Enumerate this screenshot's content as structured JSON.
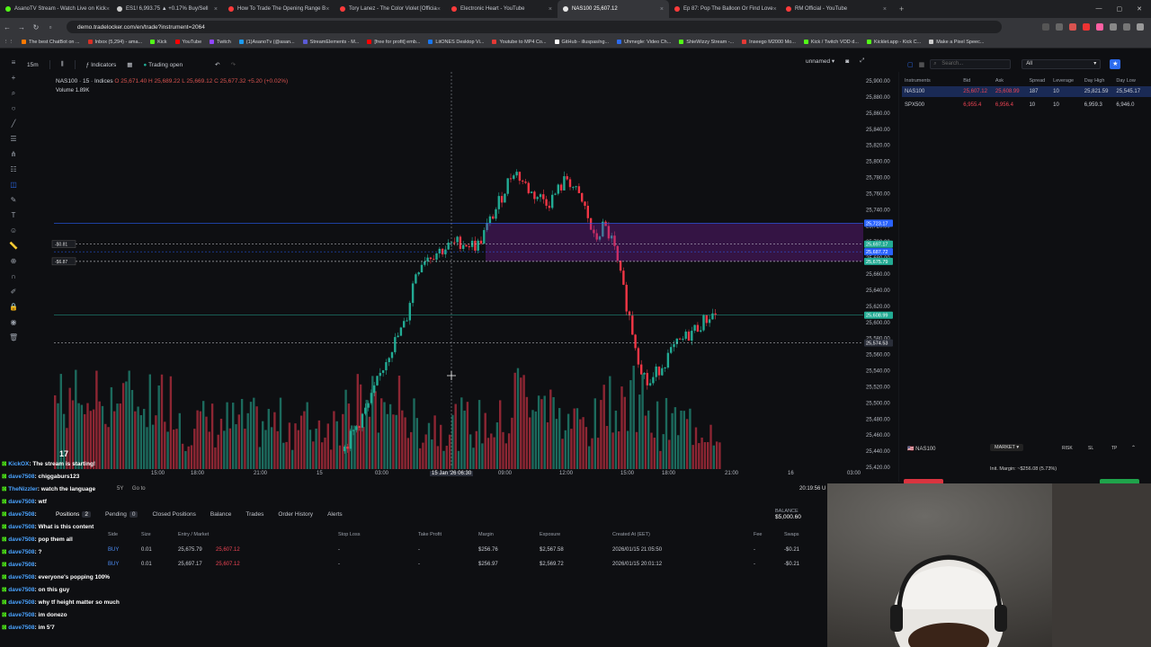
{
  "browser": {
    "tabs": [
      {
        "label": "AsanoTV Stream - Watch Live on Kick",
        "color": "#53fc18"
      },
      {
        "label": "ES1! 6,993.75 ▲ +0.17% Buy/Sell",
        "color": "#cccccc"
      },
      {
        "label": "How To Trade The Opening Range B",
        "color": "#ff3b3b"
      },
      {
        "label": "Tory Lanez - The Color Violet [Officia",
        "color": "#ff3b3b"
      },
      {
        "label": "Electronic Heart - YouTube",
        "color": "#ff3b3b"
      },
      {
        "label": "NAS100 25,607.12",
        "color": "#e8e8e8",
        "active": true
      },
      {
        "label": "Ep 87: Pop The Balloon Or Find Love",
        "color": "#ff3b3b"
      },
      {
        "label": "RM Official - YouTube",
        "color": "#ff3b3b"
      }
    ],
    "new_tab": "+",
    "url": "demo.tradelocker.com/en/trade?instrument=2064",
    "bookmarks": [
      {
        "label": "The best ChatBot on ...",
        "color": "#ff7a00"
      },
      {
        "label": "Inbox (5,294) - ama...",
        "color": "#d93025"
      },
      {
        "label": "Kick",
        "color": "#53fc18"
      },
      {
        "label": "YouTube",
        "color": "#ff0000"
      },
      {
        "label": "Twitch",
        "color": "#9146ff"
      },
      {
        "label": "(1)AsanoTv (@asan...",
        "color": "#1d9bf0"
      },
      {
        "label": "StreamElements - M...",
        "color": "#5b5bd6"
      },
      {
        "label": "[free for profit] emb...",
        "color": "#ff0000"
      },
      {
        "label": "LitONES Desktop Vi...",
        "color": "#1877f2"
      },
      {
        "label": "Youtube to MP4 Co...",
        "color": "#e53935"
      },
      {
        "label": "GitHub - illuspas/ng...",
        "color": "#ffffff"
      },
      {
        "label": "Uhmegle: Video Ch...",
        "color": "#2d6cf0"
      },
      {
        "label": "ShieWizzy Stream -...",
        "color": "#53fc18"
      },
      {
        "label": "Inseego M2000 Mo...",
        "color": "#e53935"
      },
      {
        "label": "Kick / Twitch VOD d...",
        "color": "#53fc18"
      },
      {
        "label": "Kicklet.app - Kick C...",
        "color": "#53fc18"
      },
      {
        "label": "Make a Pixel Speec...",
        "color": "#cccccc"
      }
    ]
  },
  "toolbar": {
    "timeframe": "15m",
    "indicators": "Indicators",
    "trading_open": "Trading open",
    "layout_name": "unnamed"
  },
  "legend": {
    "symbol": "NAS100 · 15 · Indices",
    "ohlc": "O 25,671.40  H 25,689.22  L 25,669.12  C 25,677.32  +5.20 (+0.02%)",
    "volume": "Volume",
    "volume_value": "1.89K"
  },
  "chart_data": {
    "type": "candlestick",
    "price_axis": [
      "25,900.00",
      "25,880.00",
      "25,860.00",
      "25,840.00",
      "25,820.00",
      "25,800.00",
      "25,780.00",
      "25,760.00",
      "25,740.00",
      "25,720.00",
      "25,700.00",
      "25,680.00",
      "25,660.00",
      "25,640.00",
      "25,620.00",
      "25,600.00",
      "25,580.00",
      "25,560.00",
      "25,540.00",
      "25,520.00",
      "25,500.00",
      "25,480.00",
      "25,460.00",
      "25,440.00",
      "25,420.00"
    ],
    "price_range": [
      25420,
      25900
    ],
    "time_axis": [
      "15:00",
      "18:00",
      "21:00",
      "15",
      "03:00",
      "15 Jan '26  06:30",
      "09:00",
      "12:00",
      "15:00",
      "18:00",
      "21:00",
      "16",
      "03:00"
    ],
    "price_tags": [
      {
        "label": "25,723.17",
        "color": "#2962ff"
      },
      {
        "label": "25,697.17",
        "color": "#22ab94"
      },
      {
        "label": "25,687.72",
        "color": "#2962ff"
      },
      {
        "label": "25,675.79",
        "color": "#22ab94"
      },
      {
        "label": "25,608.99",
        "color": "#22ab94"
      },
      {
        "label": "25,574.53",
        "color": "#2a2e39"
      }
    ],
    "position_markers": [
      "-$0.81",
      "-$6.87"
    ],
    "time_readout": "20:19:56 U",
    "lines": [
      {
        "name": "tp",
        "value": 25723.17,
        "color": "#2962ff"
      },
      {
        "name": "entry-1",
        "value": 25697.17,
        "color": "#d1d4dc"
      },
      {
        "name": "entry-2",
        "value": 25687.72,
        "color": "#2962ff"
      },
      {
        "name": "entry-3",
        "value": 25675.79,
        "color": "#d1d4dc"
      },
      {
        "name": "current",
        "value": 25608.99,
        "color": "#22ab94"
      },
      {
        "name": "cursor",
        "value": 25574.53,
        "color": "#d1d4dc"
      }
    ]
  },
  "instruments": {
    "search_placeholder": "Search...",
    "filter": "All",
    "headers": [
      "Instruments",
      "Bid",
      "Ask",
      "Spread",
      "Leverage",
      "Day High",
      "Day Low"
    ],
    "rows": [
      {
        "name": "NAS100",
        "bid": "25,607.12",
        "ask": "25,608.99",
        "spread": "187",
        "leverage": "10",
        "high": "25,821.59",
        "low": "25,545.17",
        "selected": true
      },
      {
        "name": "SPX500",
        "bid": "6,955.4",
        "ask": "6,956.4",
        "spread": "10",
        "leverage": "10",
        "high": "6,959.3",
        "low": "6,946.0",
        "selected": false
      }
    ]
  },
  "order_panel": {
    "symbol": "NAS100",
    "market": "MARKET",
    "init_margin": "Init. Margin: ~$256.08 (5.73%)",
    "buttons": [
      "RISK",
      "SL",
      "TP"
    ]
  },
  "bottom": {
    "range_label": "5Y",
    "goto": "Go to",
    "tabs": [
      {
        "label": "Positions",
        "count": "2"
      },
      {
        "label": "Pending",
        "count": "0"
      },
      {
        "label": "Closed Positions"
      },
      {
        "label": "Balance"
      },
      {
        "label": "Trades"
      },
      {
        "label": "Order History"
      },
      {
        "label": "Alerts"
      }
    ],
    "balance_label": "BALANCE",
    "balance_value": "$5,000.60",
    "columns": [
      "Side",
      "Size",
      "Entry / Market",
      "Stop Loss",
      "Take Profit",
      "Margin",
      "Exposure",
      "Created At (EET)",
      "Fee",
      "Swaps"
    ],
    "rows": [
      {
        "side": "BUY",
        "size": "0.01",
        "entry": "25,675.79",
        "market": "25,607.12",
        "sl": "-",
        "tp": "-",
        "margin": "$256.76",
        "exposure": "$2,567.58",
        "created": "2026/01/15 21:05:50",
        "fee": "-",
        "swaps": "-$0.21"
      },
      {
        "side": "BUY",
        "size": "0.01",
        "entry": "25,697.17",
        "market": "25,607.12",
        "sl": "-",
        "tp": "-",
        "margin": "$256.97",
        "exposure": "$2,569.72",
        "created": "2026/01/15 20:01:12",
        "fee": "-",
        "swaps": "-$0.21"
      }
    ]
  },
  "chat": [
    {
      "user": "KickOX",
      "text": ": The stream is starting!"
    },
    {
      "user": "dave7508",
      "text": ": chiggaburs123"
    },
    {
      "user": "TheNizzler",
      "text": ": watch the language"
    },
    {
      "user": "dave7508",
      "text": ": wtf"
    },
    {
      "user": "dave7508",
      "text": ":"
    },
    {
      "user": "dave7508",
      "text": ": What is this content"
    },
    {
      "user": "dave7508",
      "text": ": pop them all"
    },
    {
      "user": "dave7508",
      "text": ": ?"
    },
    {
      "user": "dave7508",
      "text": ":"
    },
    {
      "user": "dave7508",
      "text": ": everyone's popping 100%"
    },
    {
      "user": "dave7508",
      "text": ": on this guy"
    },
    {
      "user": "dave7508",
      "text": ": why tf height matter so much"
    },
    {
      "user": "dave7508",
      "text": ": im donezo"
    },
    {
      "user": "dave7508",
      "text": ": im 5'7"
    }
  ]
}
